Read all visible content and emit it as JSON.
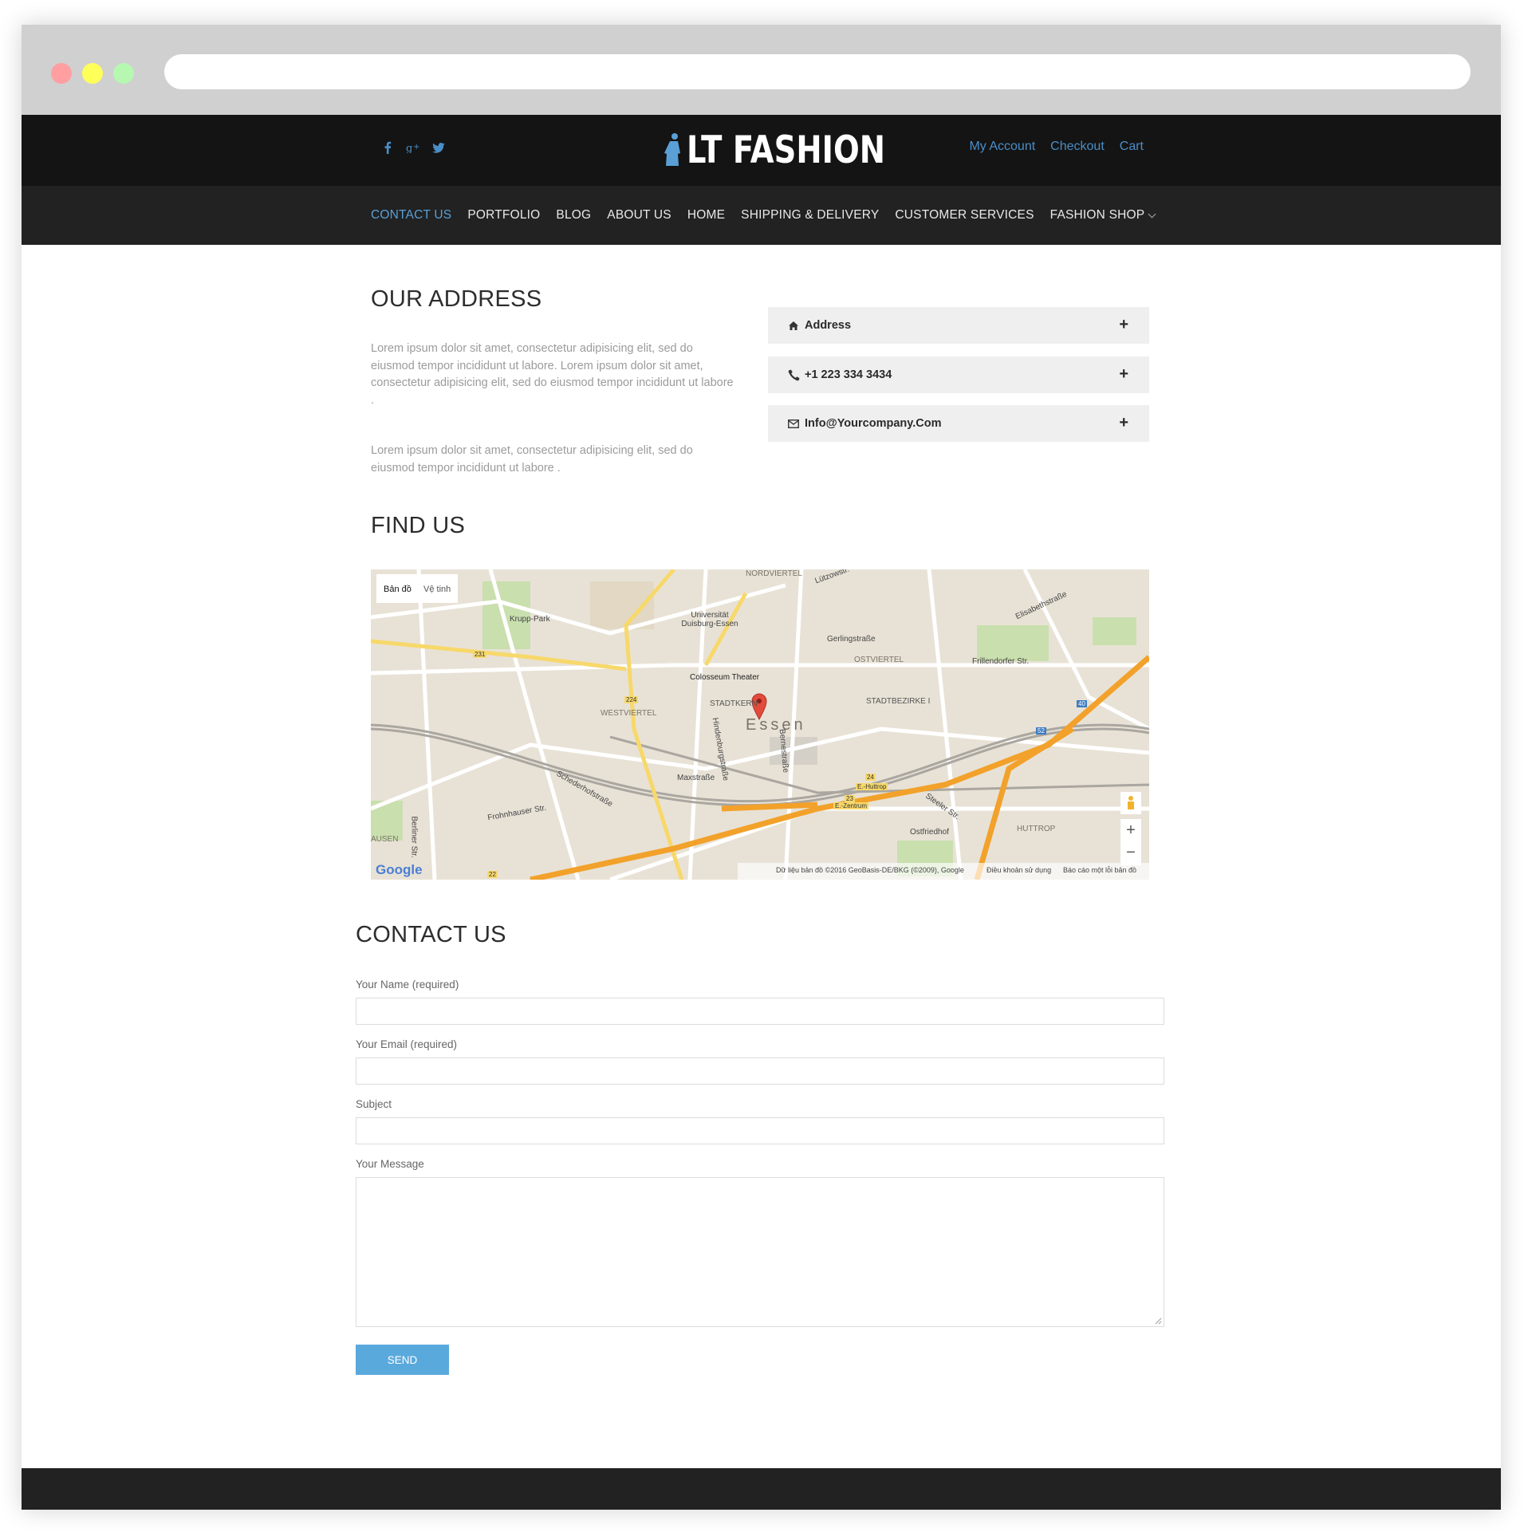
{
  "brand": {
    "name": "LT FASHION",
    "accent": "#5aa0d6"
  },
  "header": {
    "social": [
      "facebook-icon",
      "google-plus-icon",
      "twitter-icon"
    ],
    "links": [
      "My Account",
      "Checkout",
      "Cart"
    ]
  },
  "nav": {
    "items": [
      "CONTACT US",
      "PORTFOLIO",
      "BLOG",
      "ABOUT US",
      "HOME",
      "SHIPPING & DELIVERY",
      "CUSTOMER SERVICES",
      "FASHION SHOP"
    ],
    "active": "CONTACT US"
  },
  "address": {
    "title": "OUR ADDRESS",
    "para1": "Lorem ipsum dolor sit amet, consectetur adipisicing elit, sed do eiusmod tempor incididunt ut labore. Lorem ipsum dolor sit amet, consectetur adipisicing elit, sed do eiusmod tempor incididunt ut labore .",
    "para2": "Lorem ipsum dolor sit amet, consectetur adipisicing elit, sed do eiusmod tempor incididunt ut labore .",
    "accordion": [
      {
        "icon": "home-icon",
        "label": "Address"
      },
      {
        "icon": "phone-icon",
        "label": "+1 223 334 3434"
      },
      {
        "icon": "envelope-icon",
        "label": "Info@Yourcompany.Com"
      }
    ]
  },
  "find": {
    "title": "FIND US",
    "map": {
      "tabs": [
        "Bản đồ",
        "Vệ tinh"
      ],
      "city": "Essen",
      "places": [
        "NORDVIERTEL",
        "Universität Duisburg-Essen",
        "Krupp-Park",
        "Colosseum Theater",
        "STADTKERN",
        "WESTVIERTEL",
        "OSTVIERTEL",
        "STADTBEZIRKE I",
        "Gerlingstraße",
        "Frillendorfer Str.",
        "Maxstraße",
        "Schederhofstraße",
        "Frohnhauser Str.",
        "Steeler Str.",
        "Ostfriedhof",
        "HUTTROP",
        "E.-Huttrop",
        "E.-Zentrum",
        "Elisabethstraße",
        "Berliner Str.",
        "AUSEN",
        "Hindenburgstraße",
        "Bernestraße",
        "Lützowstr."
      ],
      "road_numbers": [
        "231",
        "224",
        "40",
        "52",
        "24",
        "23",
        "22"
      ],
      "attribution": "Dữ liệu bản đồ ©2016 GeoBasis-DE/BKG (©2009), Google",
      "terms": "Điều khoản sử dụng",
      "report": "Báo cáo một lỗi bản đồ",
      "google": "Google",
      "zoom_in": "+",
      "zoom_out": "−"
    }
  },
  "contact": {
    "title": "CONTACT US",
    "fields": [
      "Your Name (required)",
      "Your Email (required)",
      "Subject",
      "Your Message"
    ],
    "send": "SEND"
  }
}
